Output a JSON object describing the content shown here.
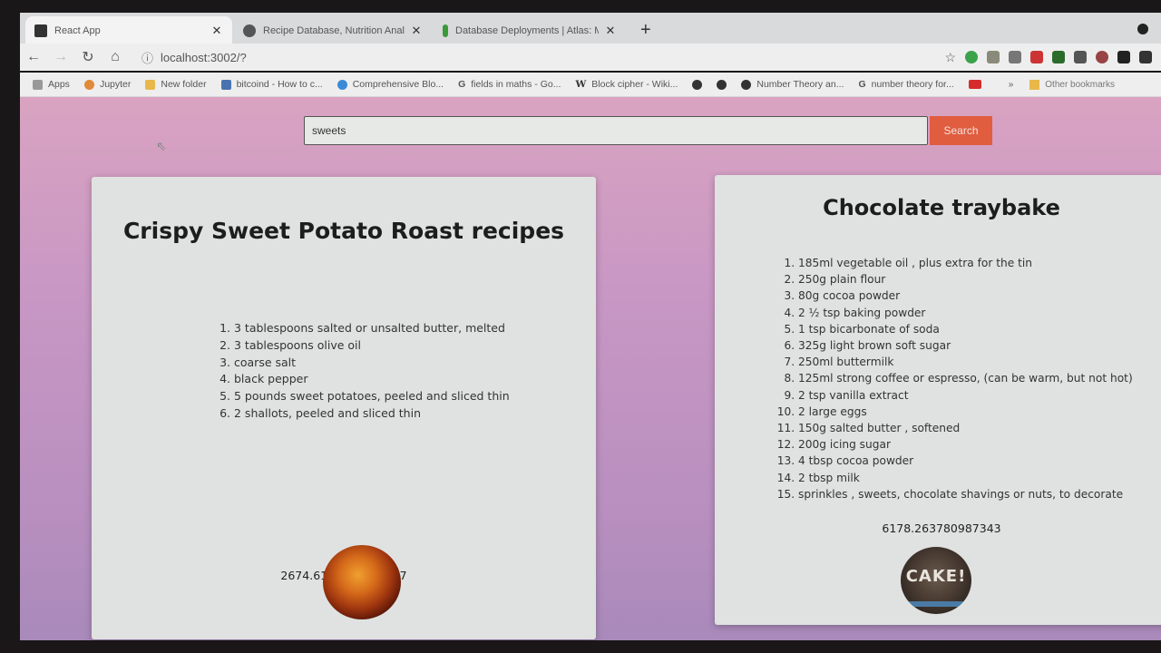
{
  "browser": {
    "tabs": [
      {
        "title": "React App",
        "active": true,
        "favicon_color": "#333333"
      },
      {
        "title": "Recipe Database, Nutrition Anal",
        "active": false,
        "favicon_color": "#555555"
      },
      {
        "title": "Database Deployments | Atlas: M",
        "active": false,
        "favicon_color": "#3a9a3a"
      }
    ],
    "new_tab": "+",
    "url": "localhost:3002/?",
    "bookmarks": [
      {
        "label": "Apps",
        "icon": "apps-grid-icon",
        "color": "#888888"
      },
      {
        "label": "Jupyter",
        "icon": "jupyter-icon",
        "color": "#e08a3a"
      },
      {
        "label": "New folder",
        "icon": "folder-icon",
        "color": "#e8b84a"
      },
      {
        "label": "bitcoind - How to c...",
        "icon": "page-icon",
        "color": "#4a72b0"
      },
      {
        "label": "Comprehensive Blo...",
        "icon": "globe-icon",
        "color": "#3a8ad6"
      },
      {
        "label": "fields in maths - Go...",
        "icon": "google-icon",
        "color": "#555555"
      },
      {
        "label": "Block cipher - Wiki...",
        "icon": "wikipedia-icon",
        "color": "#333333"
      },
      {
        "label": "",
        "icon": "globe-icon",
        "color": "#333333"
      },
      {
        "label": "",
        "icon": "globe-icon",
        "color": "#333333"
      },
      {
        "label": "Number Theory an...",
        "icon": "globe-icon",
        "color": "#333333"
      },
      {
        "label": "number theory for...",
        "icon": "google-icon",
        "color": "#555555"
      },
      {
        "label": "",
        "icon": "youtube-icon",
        "color": "#d62b2b"
      }
    ],
    "more_bookmarks": "»",
    "other_bookmarks": "Other bookmarks"
  },
  "search": {
    "value": "sweets",
    "button_label": "Search"
  },
  "recipes": [
    {
      "title": "Crispy Sweet Potato Roast recipes",
      "ingredients": [
        "3 tablespoons salted or unsalted butter, melted",
        "3 tablespoons olive oil",
        "coarse salt",
        "black pepper",
        "5 pounds sweet potatoes, peeled and sliced thin",
        "2 shallots, peeled and sliced thin"
      ],
      "score": "2674.6177933971667",
      "image": "sweet-potato-roast-photo"
    },
    {
      "title": "Chocolate traybake",
      "ingredients": [
        "185ml vegetable oil , plus extra for the tin",
        "250g plain flour",
        "80g cocoa powder",
        "2 ½ tsp baking powder",
        "1 tsp bicarbonate of soda",
        "325g light brown soft sugar",
        "250ml buttermilk",
        "125ml strong coffee or espresso, (can be warm, but not hot)",
        "2 tsp vanilla extract",
        "2 large eggs",
        "150g salted butter , softened",
        "200g icing sugar",
        "4 tbsp cocoa powder",
        "2 tbsp milk",
        "sprinkles , sweets, chocolate shavings or nuts, to decorate"
      ],
      "score": "6178.263780987343",
      "image_text": "CAKE!",
      "image": "chocolate-cake-photo"
    }
  ]
}
